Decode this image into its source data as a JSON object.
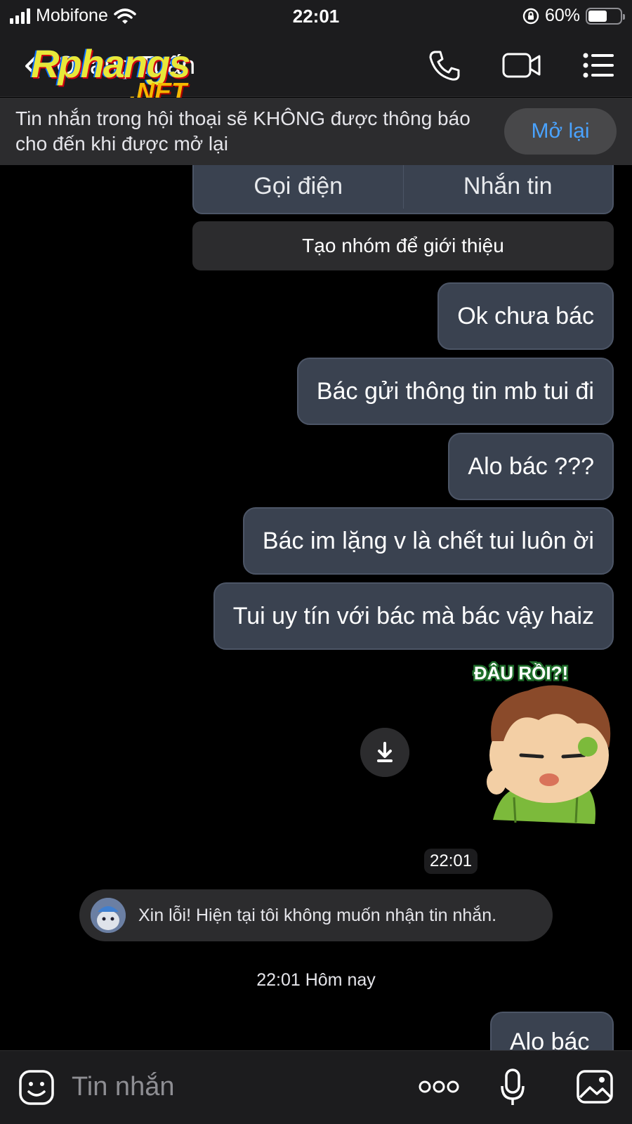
{
  "status_bar": {
    "carrier": "Mobifone",
    "time": "22:01",
    "battery": "60%",
    "battery_level": 0.6
  },
  "header": {
    "contact_name": "Quang Tuấn",
    "watermark_main": "Rphangs",
    "watermark_net": ".NET",
    "icons": [
      "back-chevron-icon",
      "phone-icon",
      "video-call-icon",
      "menu-list-icon"
    ]
  },
  "banner": {
    "text": "Tin nhắn trong hội thoại sẽ KHÔNG được thông báo cho đến khi được mở lại",
    "button": "Mở lại"
  },
  "contact_card": {
    "call": "Gọi điện",
    "message": "Nhắn tin",
    "create_group": "Tạo nhóm để giới thiệu"
  },
  "messages": [
    {
      "text": "Ok chưa bác"
    },
    {
      "text": "Bác gửi thông tin mb tui đi"
    },
    {
      "text": "Alo bác ???"
    },
    {
      "text": "Bác im lặng v là chết tui luôn ời"
    },
    {
      "text": "Tui uy tín với bác mà bác vậy haiz"
    }
  ],
  "sticker": {
    "caption": "ĐÂU RỒI?!"
  },
  "sticker_time": "22:01",
  "auto_reply": {
    "text": "Xin lỗi! Hiện tại tôi không muốn nhận tin nhắn."
  },
  "date_separator": "22:01 Hôm nay",
  "last_message": "Alo bác",
  "composer": {
    "placeholder": "Tin nhắn"
  }
}
